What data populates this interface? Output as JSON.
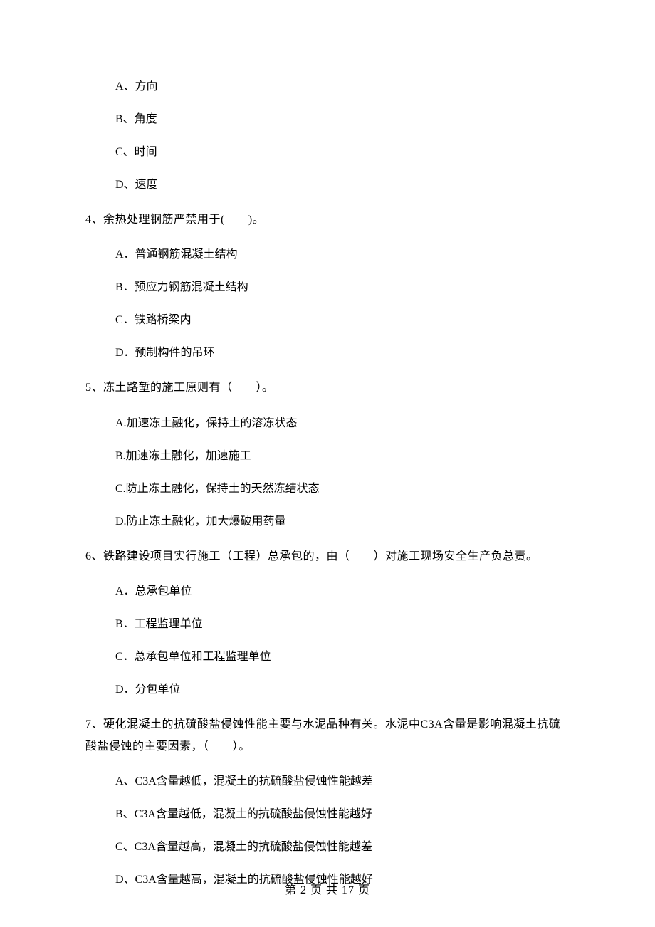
{
  "q3": {
    "options": {
      "A": "A、方向",
      "B": "B、角度",
      "C": "C、时间",
      "D": "D、速度"
    }
  },
  "q4": {
    "text": "4、余热处理钢筋严禁用于(　　)。",
    "options": {
      "A": "A．普通钢筋混凝土结构",
      "B": "B．预应力钢筋混凝土结构",
      "C": "C．铁路桥梁内",
      "D": "D．预制构件的吊环"
    }
  },
  "q5": {
    "text": "5、冻土路堑的施工原则有（　　）。",
    "options": {
      "A": "A.加速冻土融化，保持土的溶冻状态",
      "B": "B.加速冻土融化，加速施工",
      "C": "C.防止冻土融化，保持土的天然冻结状态",
      "D": "D.防止冻土融化，加大爆破用药量"
    }
  },
  "q6": {
    "text": "6、铁路建设项目实行施工（工程）总承包的，由（　　）对施工现场安全生产负总责。",
    "options": {
      "A": "A．总承包单位",
      "B": "B．工程监理单位",
      "C": "C．总承包单位和工程监理单位",
      "D": "D．分包单位"
    }
  },
  "q7": {
    "text": "7、硬化混凝土的抗硫酸盐侵蚀性能主要与水泥品种有关。水泥中C3A含量是影响混凝土抗硫酸盐侵蚀的主要因素，（　　）。",
    "options": {
      "A": "A、C3A含量越低，混凝土的抗硫酸盐侵蚀性能越差",
      "B": "B、C3A含量越低，混凝土的抗硫酸盐侵蚀性能越好",
      "C": "C、C3A含量越高，混凝土的抗硫酸盐侵蚀性能越差",
      "D": "D、C3A含量越高，混凝土的抗硫酸盐侵蚀性能越好"
    }
  },
  "footer": "第 2 页 共 17 页"
}
